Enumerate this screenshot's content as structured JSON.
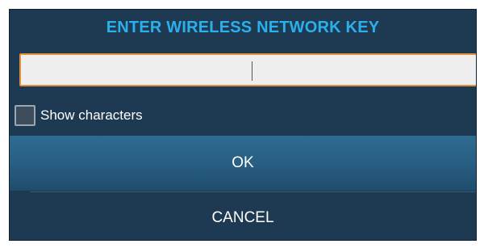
{
  "dialog": {
    "title": "ENTER WIRELESS NETWORK KEY",
    "key_input": {
      "value": "",
      "placeholder": ""
    },
    "show_characters": {
      "label": "Show characters",
      "checked": false
    },
    "ok_label": "OK",
    "cancel_label": "CANCEL"
  },
  "colors": {
    "background": "#1e3a52",
    "title": "#2ab0ec",
    "input_border": "#e0913a",
    "ok_button": "#285f83"
  }
}
